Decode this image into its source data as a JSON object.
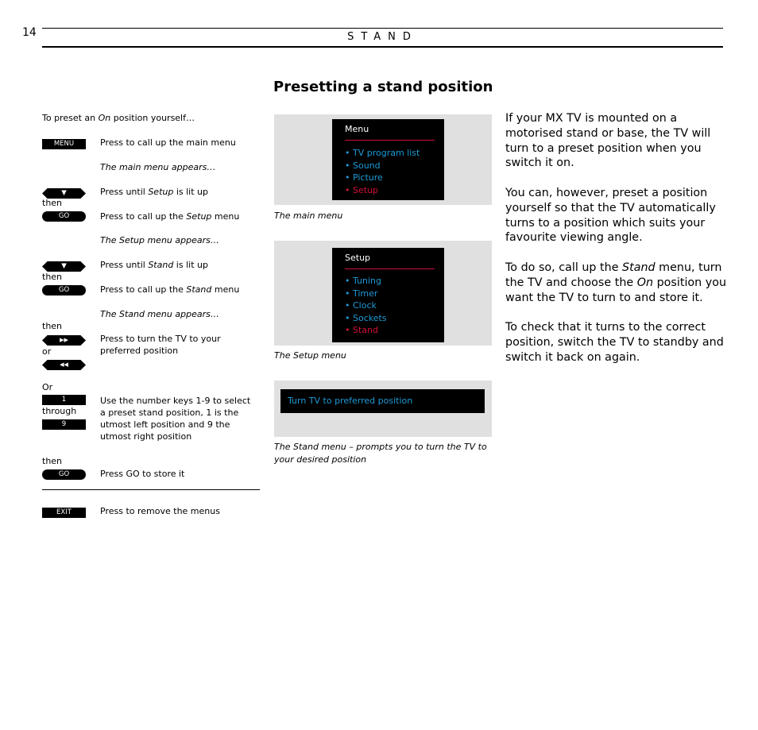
{
  "header": {
    "page_number": "14",
    "section": "STAND",
    "title": "Presetting a stand position"
  },
  "steps": {
    "intro": [
      "To preset an ",
      "On",
      " position yourself…"
    ],
    "keys": {
      "menu": "MENU",
      "down": "▼",
      "go": "GO",
      "ffwd": "▶▶",
      "rew": "◀◀",
      "one": "1",
      "nine": "9",
      "exit": "EXIT"
    },
    "connectors": {
      "then": "then",
      "or": "or",
      "Or": "Or",
      "through": "through"
    },
    "step1": "Press to call up the main menu",
    "step1_note": "The main menu appears…",
    "step2": [
      "Press until ",
      "Setup",
      " is lit up"
    ],
    "step3": [
      "Press to call up the ",
      "Setup",
      " menu"
    ],
    "step3_note": "The Setup menu appears…",
    "step4": [
      "Press until ",
      "Stand",
      " is lit up"
    ],
    "step5": [
      "Press to call up the ",
      "Stand",
      " menu"
    ],
    "step5_note": "The Stand menu appears…",
    "step6": "Press to turn the TV to your preferred position",
    "step7": "Use the number keys 1-9 to select a preset stand position, 1 is the utmost left position and 9 the utmost right position",
    "step8": "Press GO to store it",
    "step9": "Press to remove the menus"
  },
  "screens": {
    "main_menu": {
      "title": "Menu",
      "items": [
        "• TV program list",
        "• Sound",
        "• Picture",
        "• Setup"
      ],
      "caption": "The main menu"
    },
    "setup_menu": {
      "title": "Setup",
      "items": [
        "• Tuning",
        "• Timer",
        "• Clock",
        "• Sockets",
        "• Stand"
      ],
      "caption": "The Setup menu"
    },
    "stand_menu": {
      "prompt": "Turn TV to preferred position",
      "caption": "The Stand menu – prompts you to turn the TV to your desired position"
    },
    "colors": {
      "highlight": "#d0103a",
      "item": "#1f9ad6",
      "panel_bg": "#e0e0e0"
    }
  },
  "body": {
    "p1": "If your MX TV is mounted on a motorised stand or base, the TV will turn to a preset position when you switch it on.",
    "p2": "You can, however, preset a position yourself so that the TV automatically turns to a position which suits your favourite viewing angle.",
    "p3": [
      "To do so, call up the ",
      "Stand",
      " menu, turn the TV and choose the ",
      "On",
      " position you want the TV to turn to and store it."
    ],
    "p4": "To check that it turns to the correct position, switch the TV to standby and switch it back on again."
  }
}
